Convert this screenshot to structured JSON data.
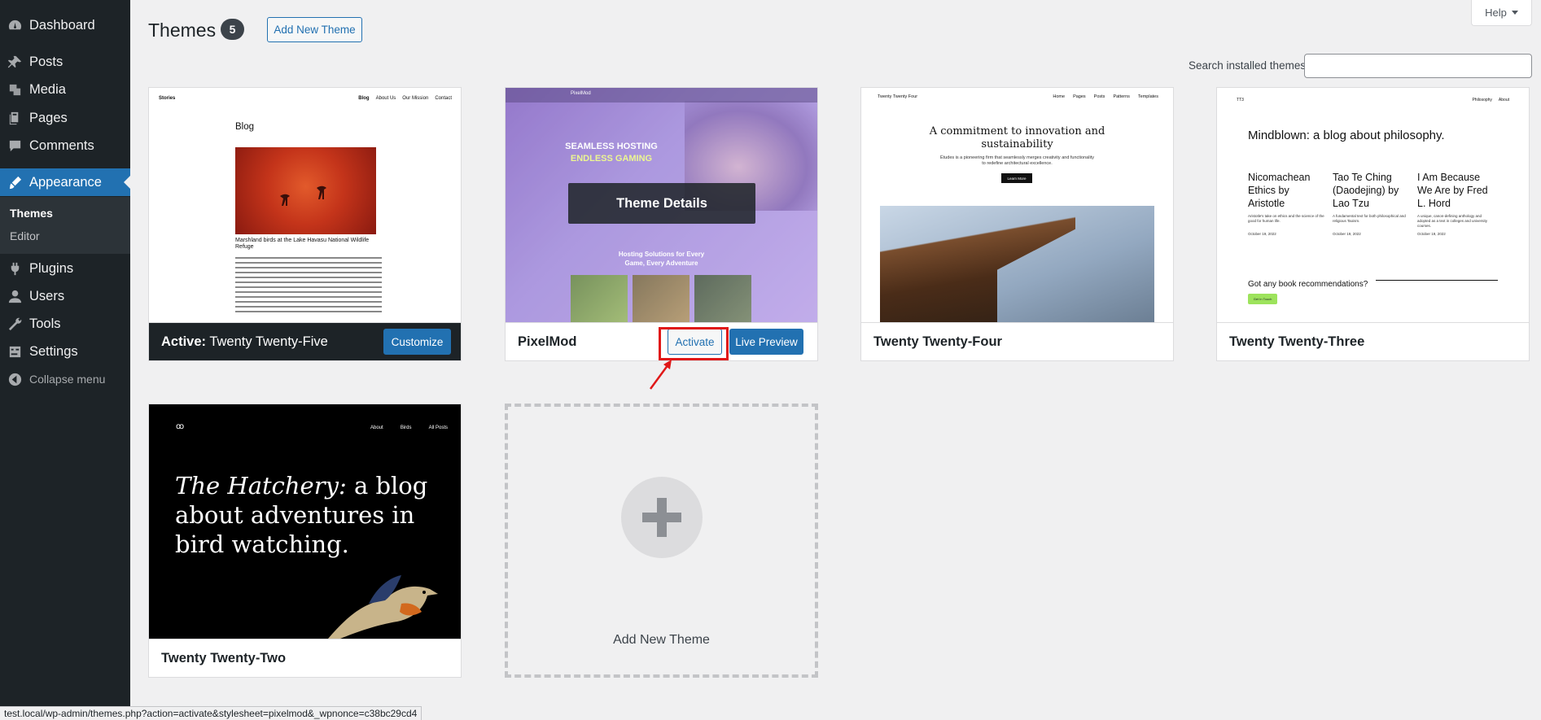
{
  "sidebar": {
    "items": [
      {
        "label": "Dashboard",
        "icon": "dashboard-icon"
      },
      {
        "label": "Posts",
        "icon": "pin-icon"
      },
      {
        "label": "Media",
        "icon": "media-icon"
      },
      {
        "label": "Pages",
        "icon": "pages-icon"
      },
      {
        "label": "Comments",
        "icon": "comment-icon"
      },
      {
        "label": "Appearance",
        "icon": "brush-icon"
      },
      {
        "label": "Plugins",
        "icon": "plugin-icon"
      },
      {
        "label": "Users",
        "icon": "user-icon"
      },
      {
        "label": "Tools",
        "icon": "wrench-icon"
      },
      {
        "label": "Settings",
        "icon": "settings-icon"
      }
    ],
    "submenu": {
      "themes": "Themes",
      "editor": "Editor"
    },
    "collapse_label": "Collapse menu",
    "accent_color": "#2271b1"
  },
  "header": {
    "title": "Themes",
    "count": "5",
    "add_new_label": "Add New Theme",
    "help_label": "Help",
    "search_label": "Search installed themes",
    "search_value": ""
  },
  "themes": {
    "t25": {
      "active_prefix": "Active:",
      "name": "Twenty Twenty-Five",
      "customize_label": "Customize",
      "shot": {
        "site_title": "Stories",
        "nav": [
          "Blog",
          "About Us",
          "Our Mission",
          "Contact"
        ],
        "heading": "Blog",
        "caption": "Marshland birds at the Lake Havasu National Wildlife Refuge"
      }
    },
    "pixelmod": {
      "name": "PixelMod",
      "details_label": "Theme Details",
      "activate_label": "Activate",
      "preview_label": "Live Preview",
      "shot": {
        "logo": "PixelMod",
        "hero_line1": "SEAMLESS HOSTING",
        "hero_line2": "ENDLESS GAMING",
        "lower_line1": "Hosting Solutions for Every",
        "lower_line2": "Game, Every Adventure"
      }
    },
    "t24": {
      "name": "Twenty Twenty-Four",
      "shot": {
        "site_title": "Twenty Twenty Four",
        "nav": [
          "Home",
          "Pages",
          "Posts",
          "Patterns",
          "Templates"
        ],
        "headline": "A commitment to innovation and sustainability",
        "sub": "Études is a pioneering firm that seamlessly merges creativity and functionality to redefine architectural excellence.",
        "button": "Learn More"
      }
    },
    "t23": {
      "name": "Twenty Twenty-Three",
      "shot": {
        "site_title": "TT3",
        "nav": [
          "Philosophy",
          "About"
        ],
        "heading": "Mindblown: a blog about philosophy.",
        "posts": [
          {
            "title": "Nicomachean Ethics by Aristotle",
            "excerpt": "Aristotle's take on ethics and the science of the good for human life.",
            "date": "October 19, 2022"
          },
          {
            "title": "Tao Te Ching (Daodejing) by Lao Tzu",
            "excerpt": "A fundamental text for both philosophical and religious Taoism.",
            "date": "October 19, 2022"
          },
          {
            "title": "I Am Because We Are by Fred L. Hord",
            "excerpt": "A unique, canon-defining anthology and adopted as a text in colleges and university courses.",
            "date": "October 19, 2022"
          }
        ],
        "question": "Got any book recommendations?",
        "button": "Get In Touch"
      }
    },
    "t22": {
      "name": "Twenty Twenty-Two",
      "shot": {
        "logo": "ꝏ",
        "nav": [
          "About",
          "Birds",
          "All Posts"
        ],
        "hero_italic": "The Hatchery:",
        "hero_rest": " a blog about adventures in bird watching."
      }
    }
  },
  "add_card": {
    "label": "Add New Theme"
  },
  "statusbar": {
    "url": "test.local/wp-admin/themes.php?action=activate&stylesheet=pixelmod&_wpnonce=c38bc29cd4"
  }
}
